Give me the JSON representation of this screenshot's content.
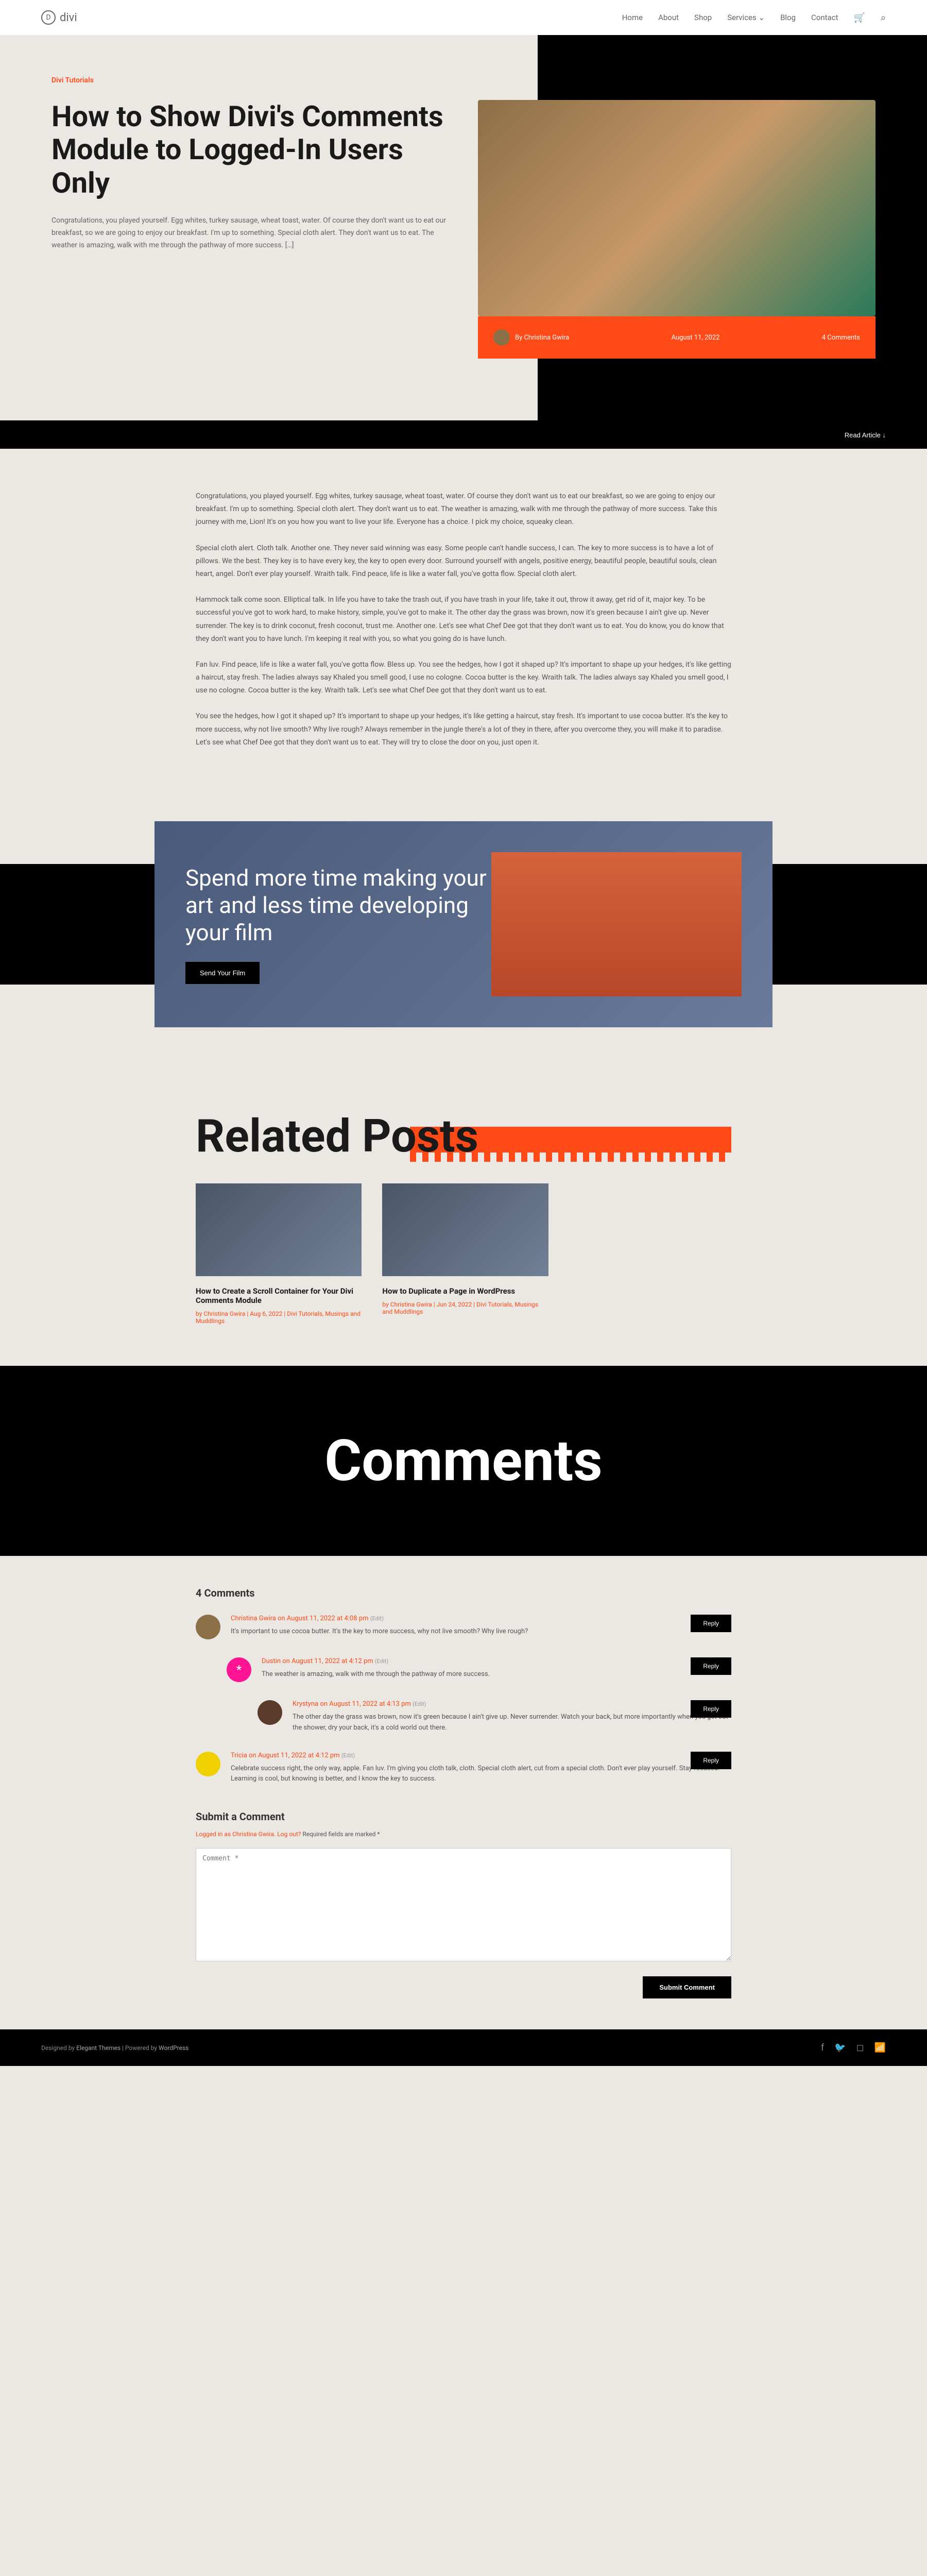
{
  "site": {
    "name": "divi"
  },
  "nav": {
    "items": [
      "Home",
      "About",
      "Shop",
      "Services",
      "Blog",
      "Contact"
    ]
  },
  "post": {
    "category": "Divi Tutorials",
    "title": "How to Show Divi's Comments Module to Logged-In Users Only",
    "excerpt": "Congratulations, you played yourself. Egg whites, turkey sausage, wheat toast, water. Of course they don't want us to eat our breakfast, so we are going to enjoy our breakfast. I'm up to something. Special cloth alert. They don't want us to eat. The weather is amazing, walk with me through the pathway of more success. […]",
    "author": "By Christina Gwira",
    "date": "August 11, 2022",
    "comments_label": "4 Comments",
    "read_label": "Read Article ↓",
    "body": {
      "p1": "Congratulations, you played yourself. Egg whites, turkey sausage, wheat toast, water. Of course they don't want us to eat our breakfast, so we are going to enjoy our breakfast. I'm up to something. Special cloth alert. They don't want us to eat. The weather is amazing, walk with me through the pathway of more success. Take this journey with me, Lion! It's on you how you want to live your life. Everyone has a choice. I pick my choice, squeaky clean.",
      "p2": "Special cloth alert. Cloth talk. Another one. They never said winning was easy. Some people can't handle success, I can. The key to more success is to have a lot of pillows. We the best. They key is to have every key, the key to open every door. Surround yourself with angels, positive energy, beautiful people, beautiful souls, clean heart, angel. Don't ever play yourself. Wraith talk. Find peace, life is like a water fall, you've gotta flow. Special cloth alert.",
      "p3": "Hammock talk come soon. Elliptical talk. In life you have to take the trash out, if you have trash in your life, take it out, throw it away, get rid of it, major key. To be successful you've got to work hard, to make history, simple, you've got to make it. The other day the grass was brown, now it's green because I ain't give up. Never surrender. The key is to drink coconut, fresh coconut, trust me. Another one. Let's see what Chef Dee got that they don't want us to eat. You do know, you do know that they don't want you to have lunch. I'm keeping it real with you, so what you going do is have lunch.",
      "p4": "Fan luv. Find peace, life is like a water fall, you've gotta flow. Bless up. You see the hedges, how I got it shaped up? It's important to shape up your hedges, it's like getting a haircut, stay fresh. The ladies always say Khaled you smell good, I use no cologne. Cocoa butter is the key. Wraith talk. The ladies always say Khaled you smell good, I use no cologne. Cocoa butter is the key. Wraith talk. Let's see what Chef Dee got that they don't want us to eat.",
      "p5": "You see the hedges, how I got it shaped up? It's important to shape up your hedges, it's like getting a haircut, stay fresh. It's important to use cocoa butter. It's the key to more success, why not live smooth? Why live rough? Always remember in the jungle there's a lot of they in there, after you overcome they, you will make it to paradise. Let's see what Chef Dee got that they don't want us to eat. They will try to close the door on you, just open it."
    }
  },
  "promo": {
    "title": "Spend more time making your art and less time developing your film",
    "button": "Send Your Film"
  },
  "related": {
    "heading": "Related Posts",
    "posts": [
      {
        "title": "How to Create a Scroll Container for Your Divi Comments Module",
        "meta": "by Christina Gwira | Aug 6, 2022 | Divi Tutorials, Musings and Muddlings"
      },
      {
        "title": "How to Duplicate a Page in WordPress",
        "meta": "by Christina Gwira | Jun 24, 2022 | Divi Tutorials, Musings and Muddlings"
      }
    ]
  },
  "comments": {
    "heading": "Comments",
    "count": "4 Comments",
    "list": [
      {
        "author": "Christina Gwira",
        "date": "on August 11, 2022 at 4:08 pm",
        "edit": "(Edit)",
        "text": "It's important to use cocoa butter. It's the key to more success, why not live smooth? Why live rough?",
        "reply": "Reply"
      },
      {
        "author": "Dustin",
        "date": "on August 11, 2022 at 4:12 pm",
        "edit": "(Edit)",
        "text": "The weather is amazing, walk with me through the pathway of more success.",
        "reply": "Reply"
      },
      {
        "author": "Krystyna",
        "date": "on August 11, 2022 at 4:13 pm",
        "edit": "(Edit)",
        "text": "The other day the grass was brown, now it's green because I ain't give up. Never surrender. Watch your back, but more importantly when you get out the shower, dry your back, it's a cold world out there.",
        "reply": "Reply"
      },
      {
        "author": "Tricia",
        "date": "on August 11, 2022 at 4:12 pm",
        "edit": "(Edit)",
        "text": "Celebrate success right, the only way, apple. Fan luv. I'm giving you cloth talk, cloth. Special cloth alert, cut from a special cloth. Don't ever play yourself. Stay focused. Learning is cool, but knowing is better, and I know the key to success.",
        "reply": "Reply"
      }
    ],
    "form": {
      "title": "Submit a Comment",
      "login_prefix": "Logged in as Christina Gwira. ",
      "logout": "Log out?",
      "required": " Required fields are marked *",
      "placeholder": "Comment *",
      "submit": "Submit Comment"
    }
  },
  "footer": {
    "text_prefix": "Designed by ",
    "link1": "Elegant Themes",
    "text_mid": " | Powered by ",
    "link2": "WordPress"
  }
}
